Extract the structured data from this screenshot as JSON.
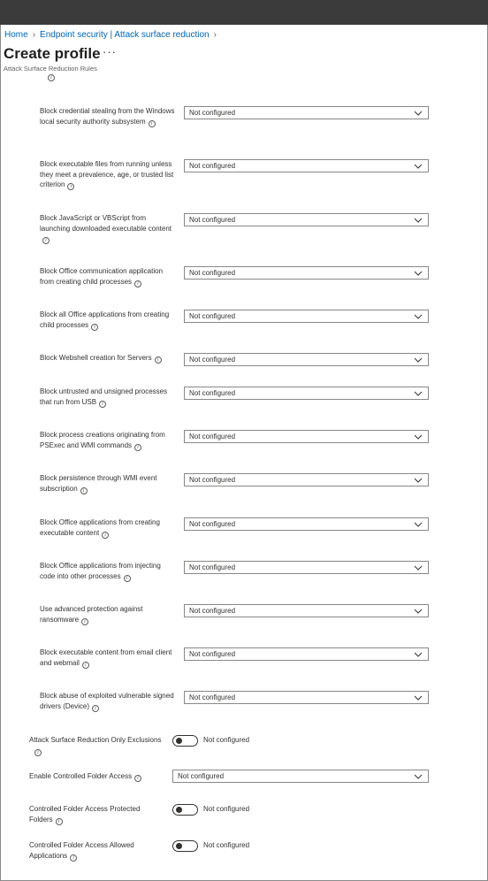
{
  "breadcrumb": {
    "home": "Home",
    "section": "Endpoint security | Attack surface reduction"
  },
  "header": {
    "title": "Create profile",
    "more": "···",
    "subtitle": "Attack Surface Reduction Rules"
  },
  "info_glyph": "i",
  "rules": [
    {
      "label": "Block credential stealing from the Windows local security authority subsystem",
      "value": "Not configured"
    },
    {
      "label": "Block executable files from running unless they meet a prevalence, age, or trusted list criterion",
      "value": "Not configured"
    },
    {
      "label": "Block JavaScript or VBScript from launching downloaded executable content",
      "value": "Not configured"
    },
    {
      "label": "Block Office communication application from creating child processes",
      "value": "Not configured"
    },
    {
      "label": "Block all Office applications from creating child processes",
      "value": "Not configured"
    },
    {
      "label": "Block Webshell creation for Servers",
      "value": "Not configured"
    },
    {
      "label": "Block untrusted and unsigned processes that run from USB",
      "value": "Not configured"
    },
    {
      "label": "Block process creations originating from PSExec and WMI commands",
      "value": "Not configured"
    },
    {
      "label": "Block persistence through WMI event subscription",
      "value": "Not configured"
    },
    {
      "label": "Block Office applications from creating executable content",
      "value": "Not configured"
    },
    {
      "label": "Block Office applications from injecting code into other processes",
      "value": "Not configured"
    },
    {
      "label": "Use advanced protection against ransomware",
      "value": "Not configured"
    },
    {
      "label": "Block executable content from email client and webmail",
      "value": "Not configured"
    },
    {
      "label": "Block abuse of exploited vulnerable signed drivers (Device)",
      "value": "Not configured"
    }
  ],
  "asr_exclusions": {
    "label": "Attack Surface Reduction Only Exclusions",
    "value": "Not configured"
  },
  "controlled_folder_access": {
    "label": "Enable Controlled Folder Access",
    "value": "Not configured"
  },
  "cfa_protected_folders": {
    "label": "Controlled Folder Access Protected Folders",
    "value": "Not configured"
  },
  "cfa_allowed_apps": {
    "label": "Controlled Folder Access Allowed Applications",
    "value": "Not configured"
  },
  "colors": {
    "link": "#0064b4",
    "topbar": "#3b3b3b",
    "text": "#323130",
    "border": "#8a8886"
  }
}
